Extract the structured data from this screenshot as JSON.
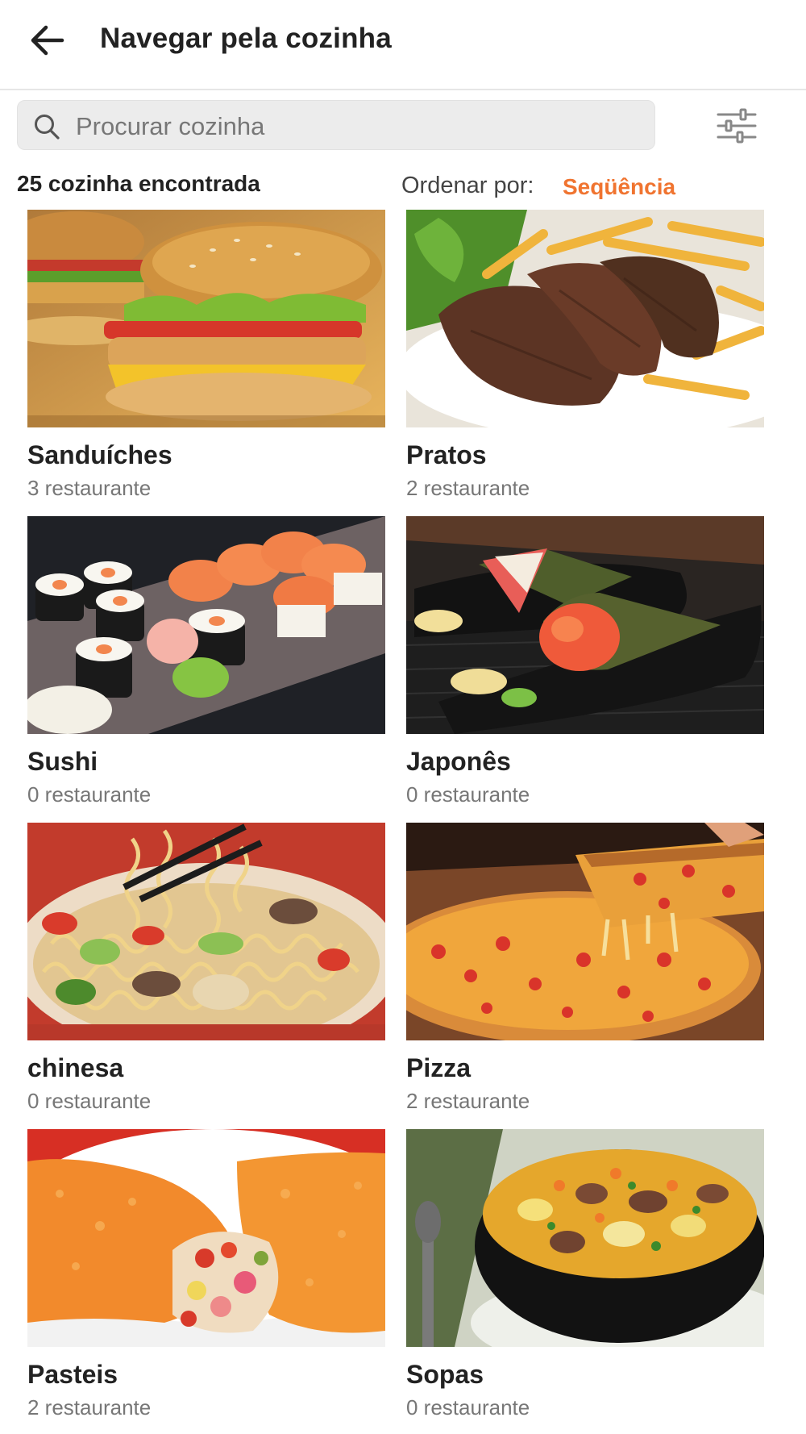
{
  "header": {
    "title": "Navegar pela cozinha",
    "back_icon": "arrow-left-icon"
  },
  "search": {
    "placeholder": "Procurar cozinha",
    "value": "",
    "icon": "search-icon"
  },
  "filter": {
    "icon": "sliders-icon"
  },
  "results": {
    "count_text": "25 cozinha encontrada",
    "sort_label": "Ordenar por:",
    "sort_value": "Seqüência"
  },
  "colors": {
    "accent": "#f07430"
  },
  "cuisines": [
    {
      "name": "Sanduíches",
      "count": "3 restaurante",
      "image": "burger-photo"
    },
    {
      "name": "Pratos",
      "count": "2 restaurante",
      "image": "steak-fries-photo"
    },
    {
      "name": "Sushi",
      "count": "0 restaurante",
      "image": "sushi-photo"
    },
    {
      "name": "Japonês",
      "count": "0 restaurante",
      "image": "temaki-photo"
    },
    {
      "name": "chinesa",
      "count": "0 restaurante",
      "image": "noodles-photo"
    },
    {
      "name": "Pizza",
      "count": "2 restaurante",
      "image": "pizza-photo"
    },
    {
      "name": "Pasteis",
      "count": "2 restaurante",
      "image": "pastel-photo"
    },
    {
      "name": "Sopas",
      "count": "0 restaurante",
      "image": "soup-photo"
    }
  ]
}
